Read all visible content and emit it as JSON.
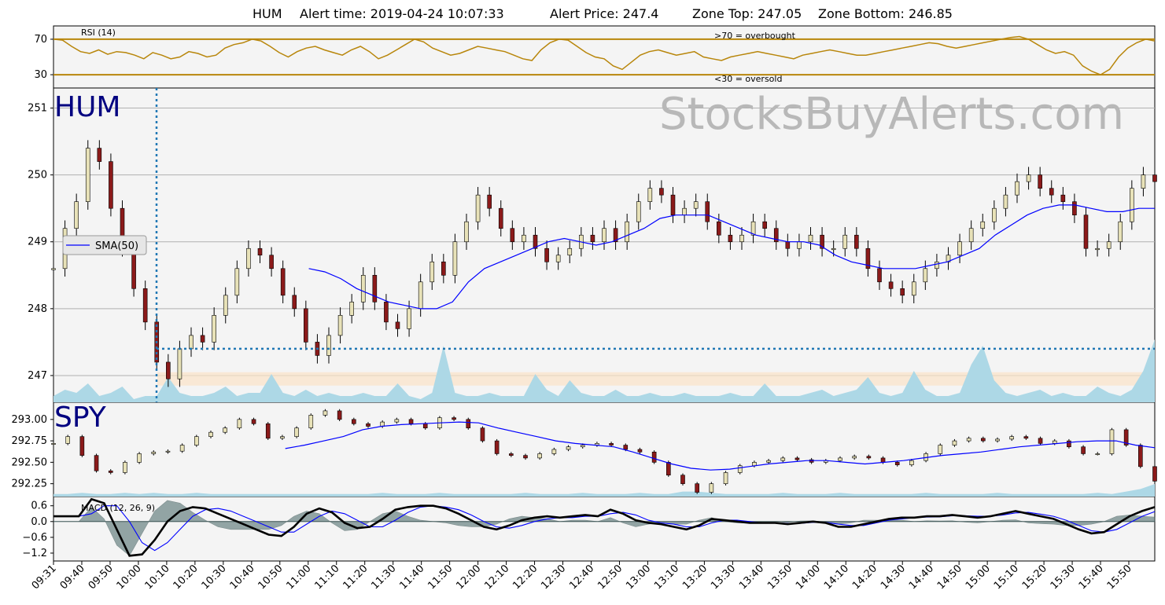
{
  "title": {
    "symbol": "HUM",
    "alert_time": "Alert time: 2019-04-24 10:07:33",
    "alert_price": "Alert Price: 247.4",
    "zone_top": "Zone Top: 247.05",
    "zone_bottom": "Zone Bottom: 246.85"
  },
  "watermark": "StocksBuyAlerts.com",
  "colors": {
    "panel_bg": "#f4f4f4",
    "rsi_line": "#b8860b",
    "sma_line": "#0000ff",
    "volume": "#add8e6",
    "alert_marker": "#1f77b4",
    "zone_fill": "#fbe3c8",
    "macd_line": "#000000",
    "signal_line": "#0000ff",
    "histogram": "#5f7a7a",
    "ticker_text": "#000080"
  },
  "chart_data": [
    {
      "type": "line",
      "name": "rsi",
      "title": "RSI (14)",
      "ylim": [
        15,
        85
      ],
      "yticks": [
        "70",
        "30"
      ],
      "thresholds": [
        70,
        30
      ],
      "annotations": [
        ">70 = overbought",
        "<30 = oversold"
      ],
      "values": [
        70,
        69,
        62,
        56,
        54,
        58,
        53,
        56,
        55,
        52,
        48,
        55,
        52,
        48,
        50,
        56,
        54,
        50,
        52,
        60,
        64,
        66,
        70,
        68,
        62,
        55,
        50,
        56,
        60,
        62,
        58,
        55,
        52,
        58,
        62,
        56,
        48,
        52,
        58,
        64,
        70,
        67,
        60,
        56,
        52,
        54,
        58,
        62,
        60,
        58,
        56,
        52,
        48,
        46,
        58,
        66,
        70,
        69,
        62,
        55,
        50,
        48,
        40,
        36,
        44,
        52,
        56,
        58,
        55,
        52,
        54,
        56,
        50,
        48,
        46,
        50,
        52,
        54,
        56,
        54,
        52,
        50,
        48,
        52,
        54,
        56,
        58,
        56,
        54,
        52,
        52,
        54,
        56,
        58,
        60,
        62,
        64,
        66,
        65,
        62,
        60,
        62,
        64,
        66,
        68,
        70,
        72,
        73,
        70,
        64,
        58,
        54,
        56,
        52,
        40,
        34,
        30,
        36,
        50,
        60,
        66,
        70,
        68
      ],
      "grid": false
    },
    {
      "type": "line",
      "name": "hum_price",
      "title": "HUM",
      "ylabel": "",
      "ylim": [
        246.6,
        251.3
      ],
      "yticks": [
        251,
        250,
        249,
        248,
        247
      ],
      "grid": true,
      "legend": {
        "position": "left",
        "entries": [
          "SMA(50)"
        ]
      },
      "close": [
        248.6,
        249.2,
        249.6,
        250.4,
        250.2,
        249.5,
        248.9,
        248.3,
        247.8,
        247.2,
        246.95,
        247.4,
        247.6,
        247.5,
        247.9,
        248.2,
        248.6,
        248.9,
        248.8,
        248.6,
        248.2,
        248.0,
        247.5,
        247.3,
        247.6,
        247.9,
        248.1,
        248.5,
        248.1,
        247.8,
        247.7,
        248.0,
        248.4,
        248.7,
        248.5,
        249.0,
        249.3,
        249.7,
        249.5,
        249.2,
        249.0,
        249.1,
        248.9,
        248.7,
        248.8,
        248.9,
        249.1,
        249.0,
        249.2,
        249.0,
        249.3,
        249.6,
        249.8,
        249.7,
        249.4,
        249.5,
        249.6,
        249.3,
        249.1,
        249.0,
        249.1,
        249.3,
        249.2,
        249.0,
        248.9,
        249.0,
        249.1,
        248.9,
        248.9,
        249.1,
        248.9,
        248.6,
        248.4,
        248.3,
        248.2,
        248.4,
        248.6,
        248.7,
        248.8,
        249.0,
        249.2,
        249.3,
        249.5,
        249.7,
        249.9,
        250.0,
        249.8,
        249.7,
        249.6,
        249.4,
        248.9,
        248.9,
        249.0,
        249.3,
        249.8,
        250.0,
        249.9
      ],
      "sma50": [
        null,
        null,
        null,
        null,
        null,
        null,
        null,
        null,
        null,
        null,
        null,
        null,
        null,
        null,
        null,
        null,
        248.6,
        248.55,
        248.45,
        248.3,
        248.2,
        248.1,
        248.05,
        248.0,
        248.0,
        248.1,
        248.4,
        248.6,
        248.7,
        248.8,
        248.9,
        249.0,
        249.05,
        249.0,
        248.95,
        249.0,
        249.1,
        249.2,
        249.35,
        249.4,
        249.4,
        249.4,
        249.3,
        249.2,
        249.1,
        249.05,
        249.0,
        249.0,
        248.95,
        248.8,
        248.7,
        248.65,
        248.6,
        248.6,
        248.6,
        248.65,
        248.7,
        248.8,
        248.9,
        249.1,
        249.25,
        249.4,
        249.5,
        249.55,
        249.55,
        249.5,
        249.45,
        249.45,
        249.5,
        249.5
      ],
      "alert_price": 247.4,
      "zone": [
        246.85,
        247.05
      ],
      "volume": [
        2,
        4,
        3,
        6,
        2,
        3,
        5,
        1,
        2,
        2,
        8,
        3,
        2,
        2,
        3,
        5,
        2,
        3,
        3,
        9,
        3,
        2,
        4,
        2,
        3,
        2,
        2,
        3,
        2,
        2,
        6,
        2,
        1,
        3,
        18,
        3,
        2,
        2,
        3,
        2,
        2,
        2,
        9,
        4,
        2,
        7,
        3,
        2,
        2,
        4,
        2,
        2,
        3,
        2,
        2,
        3,
        2,
        2,
        2,
        3,
        2,
        2,
        6,
        2,
        2,
        2,
        3,
        4,
        2,
        3,
        4,
        8,
        3,
        2,
        3,
        10,
        4,
        2,
        2,
        3,
        12,
        18,
        7,
        3,
        2,
        3,
        4,
        2,
        3,
        2,
        2,
        5,
        3,
        2,
        4,
        10,
        20
      ]
    },
    {
      "type": "line",
      "name": "spy_price",
      "title": "SPY",
      "ylim": [
        292.1,
        293.2
      ],
      "yticks": [
        "293.00",
        "292.75",
        "292.50",
        "292.25"
      ],
      "grid": false,
      "close": [
        292.72,
        292.8,
        292.58,
        292.4,
        292.38,
        292.5,
        292.6,
        292.62,
        292.63,
        292.7,
        292.8,
        292.85,
        292.9,
        293.0,
        292.95,
        292.78,
        292.8,
        292.9,
        293.05,
        293.1,
        293.0,
        292.95,
        292.92,
        292.97,
        293.0,
        292.95,
        292.9,
        293.02,
        293.0,
        292.9,
        292.75,
        292.6,
        292.58,
        292.55,
        292.6,
        292.65,
        292.68,
        292.7,
        292.72,
        292.7,
        292.65,
        292.62,
        292.5,
        292.35,
        292.25,
        292.15,
        292.25,
        292.38,
        292.46,
        292.5,
        292.52,
        292.55,
        292.53,
        292.5,
        292.52,
        292.55,
        292.57,
        292.55,
        292.5,
        292.47,
        292.52,
        292.6,
        292.7,
        292.75,
        292.78,
        292.75,
        292.77,
        292.8,
        292.78,
        292.72,
        292.75,
        292.68,
        292.6,
        292.6,
        292.88,
        292.7,
        292.45,
        292.28
      ],
      "sma50": [
        null,
        null,
        null,
        null,
        null,
        null,
        null,
        null,
        null,
        null,
        null,
        null,
        292.66,
        292.7,
        292.75,
        292.8,
        292.88,
        292.92,
        292.94,
        292.95,
        292.96,
        292.97,
        292.96,
        292.9,
        292.85,
        292.8,
        292.75,
        292.72,
        292.7,
        292.68,
        292.62,
        292.55,
        292.48,
        292.43,
        292.41,
        292.42,
        292.45,
        292.48,
        292.5,
        292.52,
        292.52,
        292.5,
        292.48,
        292.5,
        292.52,
        292.55,
        292.58,
        292.6,
        292.62,
        292.65,
        292.68,
        292.7,
        292.72,
        292.74,
        292.75,
        292.75,
        292.7,
        292.67
      ],
      "volume": [
        2,
        2,
        3,
        2,
        2,
        3,
        2,
        3,
        2,
        2,
        3,
        2,
        2,
        2,
        2,
        2,
        2,
        2,
        2,
        2,
        2,
        2,
        2,
        3,
        2,
        2,
        2,
        3,
        2,
        2,
        2,
        2,
        2,
        3,
        2,
        2,
        2,
        3,
        2,
        2,
        2,
        3,
        2,
        2,
        4,
        4,
        3,
        2,
        2,
        2,
        2,
        3,
        2,
        2,
        2,
        3,
        2,
        2,
        2,
        2,
        2,
        3,
        2,
        2,
        2,
        2,
        3,
        2,
        2,
        2,
        2,
        2,
        2,
        3,
        2,
        4,
        6,
        10
      ]
    },
    {
      "type": "line",
      "name": "macd",
      "title": "MACD (12, 26, 9)",
      "ylim": [
        -1.5,
        0.95
      ],
      "yticks": [
        "0.6",
        "0.0",
        "−0.6",
        "−1.2"
      ],
      "macd": [
        0.2,
        0.2,
        0.2,
        0.85,
        0.7,
        -0.3,
        -1.3,
        -1.25,
        -0.7,
        0.0,
        0.4,
        0.55,
        0.5,
        0.3,
        0.1,
        -0.1,
        -0.3,
        -0.5,
        -0.55,
        -0.2,
        0.3,
        0.5,
        0.35,
        -0.05,
        -0.25,
        -0.2,
        0.1,
        0.45,
        0.55,
        0.6,
        0.6,
        0.5,
        0.3,
        0.05,
        -0.2,
        -0.3,
        -0.15,
        0.05,
        0.15,
        0.2,
        0.15,
        0.2,
        0.25,
        0.2,
        0.45,
        0.3,
        0.05,
        -0.05,
        -0.1,
        -0.2,
        -0.3,
        -0.15,
        0.1,
        0.05,
        0.0,
        -0.05,
        -0.05,
        -0.05,
        -0.1,
        -0.05,
        0.0,
        -0.05,
        -0.2,
        -0.2,
        -0.1,
        0.0,
        0.1,
        0.15,
        0.15,
        0.2,
        0.2,
        0.25,
        0.2,
        0.15,
        0.2,
        0.3,
        0.4,
        0.3,
        0.2,
        0.1,
        -0.1,
        -0.3,
        -0.45,
        -0.4,
        -0.1,
        0.2,
        0.4,
        0.55
      ],
      "signal": [
        0.2,
        0.2,
        0.2,
        0.3,
        0.6,
        0.6,
        0.0,
        -0.8,
        -1.1,
        -0.8,
        -0.3,
        0.2,
        0.45,
        0.5,
        0.4,
        0.2,
        0.0,
        -0.2,
        -0.4,
        -0.4,
        -0.1,
        0.2,
        0.4,
        0.3,
        0.05,
        -0.2,
        -0.2,
        0.05,
        0.35,
        0.55,
        0.6,
        0.55,
        0.45,
        0.25,
        0.0,
        -0.2,
        -0.25,
        -0.15,
        0.0,
        0.1,
        0.15,
        0.15,
        0.2,
        0.2,
        0.3,
        0.35,
        0.25,
        0.05,
        -0.05,
        -0.1,
        -0.2,
        -0.2,
        -0.05,
        0.05,
        0.05,
        0.0,
        -0.05,
        -0.05,
        -0.07,
        -0.07,
        -0.03,
        -0.03,
        -0.1,
        -0.15,
        -0.15,
        -0.05,
        0.05,
        0.1,
        0.15,
        0.17,
        0.18,
        0.22,
        0.22,
        0.2,
        0.2,
        0.25,
        0.33,
        0.35,
        0.28,
        0.2,
        0.05,
        -0.15,
        -0.35,
        -0.4,
        -0.3,
        -0.05,
        0.2,
        0.38
      ]
    }
  ],
  "x_axis": {
    "tick_labels": [
      "09:31",
      "09:40",
      "09:50",
      "10:00",
      "10:10",
      "10:20",
      "10:30",
      "10:40",
      "10:50",
      "11:00",
      "11:10",
      "11:20",
      "11:30",
      "11:40",
      "11:50",
      "12:00",
      "12:10",
      "12:20",
      "12:30",
      "12:40",
      "12:50",
      "13:00",
      "13:10",
      "13:20",
      "13:30",
      "13:40",
      "13:50",
      "14:00",
      "14:10",
      "14:20",
      "14:30",
      "14:40",
      "14:50",
      "15:00",
      "15:10",
      "15:20",
      "15:30",
      "15:40",
      "15:50"
    ]
  }
}
